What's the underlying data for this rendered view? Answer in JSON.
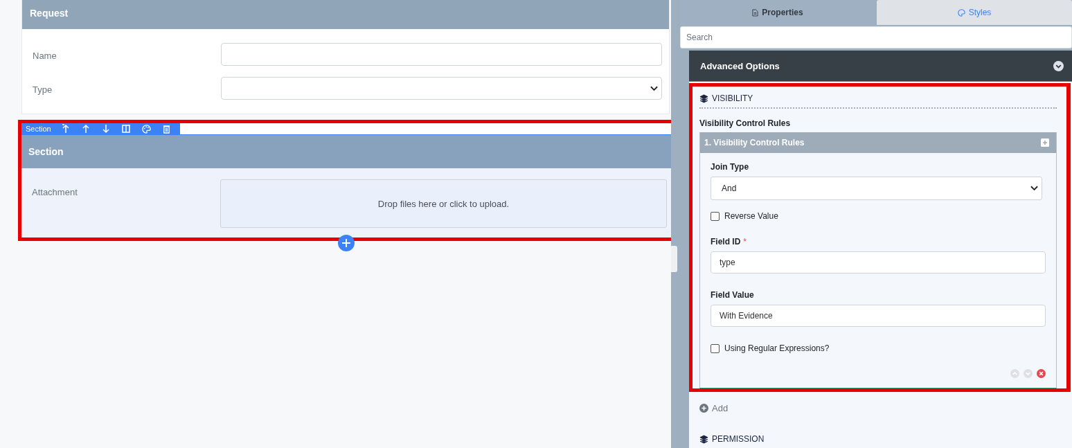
{
  "form": {
    "title": "Request",
    "fields": [
      {
        "label": "Name",
        "kind": "text"
      },
      {
        "label": "Type",
        "kind": "select"
      }
    ]
  },
  "section": {
    "toolbar_label": "Section",
    "title": "Section",
    "field_label": "Attachment",
    "dropzone": "Drop files here or click to upload."
  },
  "panel": {
    "tabs": [
      {
        "label": "Properties",
        "selected": true
      },
      {
        "label": "Styles",
        "selected": false
      }
    ],
    "search": {
      "placeholder": "Search"
    },
    "group_title": "Advanced Options",
    "visibility": {
      "heading": "VISIBILITY",
      "rules_label": "Visibility Control Rules",
      "rule": {
        "title": "1. Visibility Control Rules",
        "join_label": "Join Type",
        "join_value": "And",
        "reverse": {
          "label": "Reverse Value",
          "checked": false
        },
        "field_id_label": "Field ID",
        "field_id_required_mark": "*",
        "field_id_value": "type",
        "field_value_label": "Field Value",
        "field_value": "With Evidence",
        "regex": {
          "label": "Using Regular Expressions?",
          "checked": false
        }
      },
      "add_label": "Add"
    },
    "permission_heading": "PERMISSION"
  }
}
